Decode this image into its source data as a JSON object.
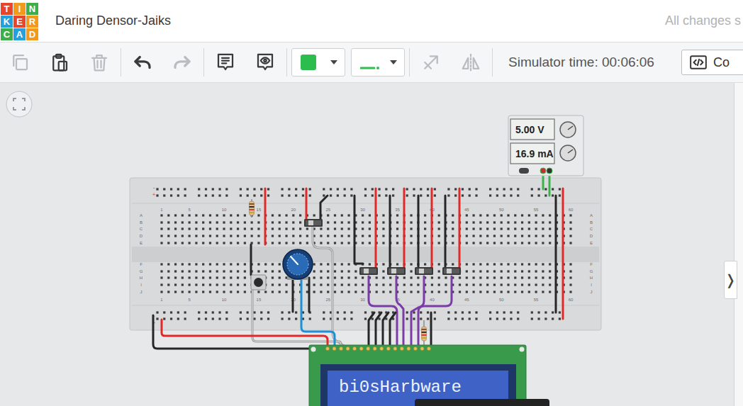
{
  "window": {
    "title": "Daring Densor-Jaiks",
    "save_status": "All changes s"
  },
  "logo": [
    {
      "char": "T",
      "color": "#e8452c"
    },
    {
      "char": "I",
      "color": "#f39a1d"
    },
    {
      "char": "N",
      "color": "#3daf4a"
    },
    {
      "char": "K",
      "color": "#24a0dc"
    },
    {
      "char": "E",
      "color": "#e8452c"
    },
    {
      "char": "R",
      "color": "#f39a1d"
    },
    {
      "char": "C",
      "color": "#3daf4a"
    },
    {
      "char": "A",
      "color": "#24a0dc"
    },
    {
      "char": "D",
      "color": "#f39a1d"
    }
  ],
  "toolbar": {
    "tools": [
      {
        "kind": "copy",
        "disabled": true
      },
      {
        "kind": "paste",
        "disabled": false
      },
      {
        "kind": "delete",
        "disabled": true
      },
      {
        "kind": "undo",
        "disabled": false
      },
      {
        "kind": "redo",
        "disabled": true
      },
      {
        "kind": "note",
        "disabled": false
      },
      {
        "kind": "notesview",
        "disabled": false
      },
      {
        "kind": "align",
        "disabled": true
      },
      {
        "kind": "mirror",
        "disabled": true
      }
    ],
    "color_swatch": {
      "color": "#2dbd4e"
    },
    "simulator_time": "Simulator time: 00:06:06",
    "code_button": "Co"
  },
  "canvas": {
    "power_supply": {
      "voltage": "5.00 V",
      "current": "16.9 mA"
    },
    "breadboard": {
      "column_labels": [
        "1",
        "5",
        "10",
        "15",
        "20",
        "25",
        "30",
        "35",
        "40",
        "45",
        "50",
        "55",
        "60"
      ],
      "row_labels_top": [
        "A",
        "B",
        "C",
        "D",
        "E"
      ],
      "row_labels_bottom": [
        "F",
        "G",
        "H",
        "I",
        "J"
      ],
      "rail_labels": [
        "-",
        "+"
      ]
    },
    "lcd": {
      "text": "bi0sHarbware"
    },
    "side_panel_toggle": "❭"
  }
}
